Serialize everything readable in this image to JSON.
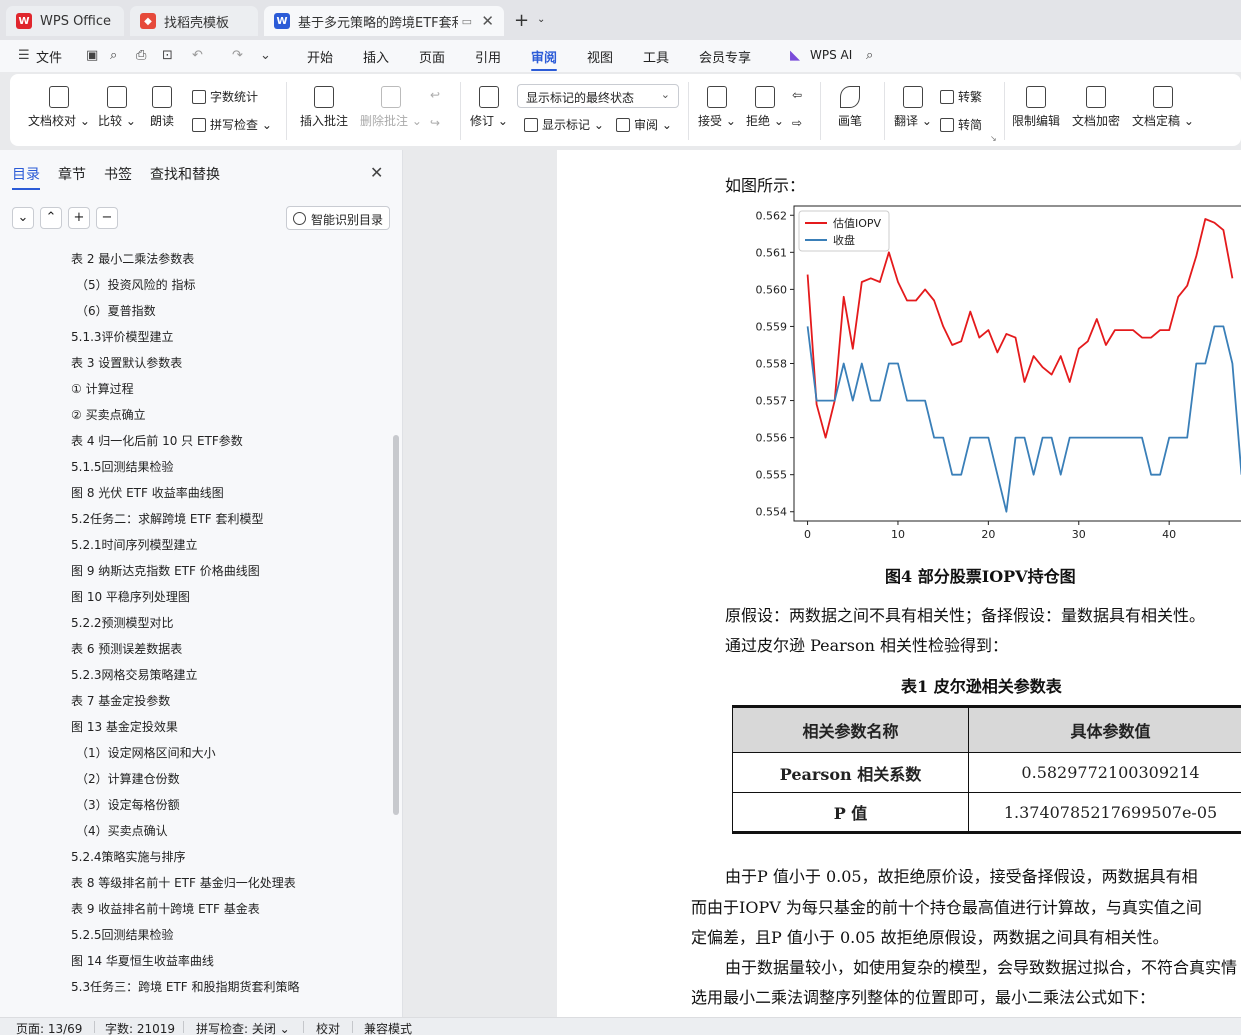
{
  "tabs": [
    {
      "label": "WPS Office"
    },
    {
      "label": "找稻壳模板"
    },
    {
      "label": "基于多元策略的跨境ETF套利策"
    }
  ],
  "menu": {
    "file": "文件",
    "items": [
      "开始",
      "插入",
      "页面",
      "引用",
      "审阅",
      "视图",
      "工具",
      "会员专享"
    ],
    "active": "审阅",
    "ai": "WPS AI"
  },
  "ribbon": {
    "doc_check": "文档校对",
    "compare": "比较",
    "read_aloud": "朗读",
    "word_count": "字数统计",
    "spell_check": "拼写检查",
    "insert_comment": "插入批注",
    "delete_comment": "删除批注",
    "revise": "修订",
    "display_dropdown": "显示标记的最终状态",
    "show_markup": "显示标记",
    "review": "审阅",
    "accept": "接受",
    "reject": "拒绝",
    "pen": "画笔",
    "translate": "翻译",
    "to_traditional": "转繁",
    "to_simplified": "转简",
    "restrict_edit": "限制编辑",
    "encrypt": "文档加密",
    "finalize": "文档定稿"
  },
  "sidebar": {
    "tabs": [
      "目录",
      "章节",
      "书签",
      "查找和替换"
    ],
    "smart_toc": "智能识别目录",
    "toc": [
      {
        "text": "表 2  最小二乘法参数表",
        "indent": 0
      },
      {
        "text": "（5）投资风险的    指标",
        "indent": 1
      },
      {
        "text": "（6）夏普指数",
        "indent": 1
      },
      {
        "text": "5.1.3评价模型建立",
        "indent": 0
      },
      {
        "text": "表 3  设置默认参数表",
        "indent": 0
      },
      {
        "text": "① 计算过程",
        "indent": 0
      },
      {
        "text": "② 买卖点确立",
        "indent": 0
      },
      {
        "text": "表 4  归一化后前 10 只 ETF参数",
        "indent": 0
      },
      {
        "text": "5.1.5回测结果检验",
        "indent": 0
      },
      {
        "text": "图 8  光伏 ETF 收益率曲线图",
        "indent": 0
      },
      {
        "text": "5.2任务二：求解跨境 ETF 套利模型",
        "indent": 0
      },
      {
        "text": "5.2.1时间序列模型建立",
        "indent": 0
      },
      {
        "text": "图 9  纳斯达克指数 ETF 价格曲线图",
        "indent": 0
      },
      {
        "text": "图 10  平稳序列处理图",
        "indent": 0
      },
      {
        "text": "5.2.2预测模型对比",
        "indent": 0
      },
      {
        "text": "表 6  预测误差数据表",
        "indent": 0
      },
      {
        "text": "5.2.3网格交易策略建立",
        "indent": 0
      },
      {
        "text": "表 7  基金定投参数",
        "indent": 0
      },
      {
        "text": "图 13  基金定投效果",
        "indent": 0
      },
      {
        "text": "（1）设定网格区间和大小",
        "indent": 1
      },
      {
        "text": "（2）计算建仓份数",
        "indent": 1
      },
      {
        "text": "（3）设定每格份额",
        "indent": 1
      },
      {
        "text": "（4）买卖点确认",
        "indent": 1
      },
      {
        "text": "5.2.4策略实施与排序",
        "indent": 0
      },
      {
        "text": "表 8  等级排名前十 ETF 基金归一化处理表",
        "indent": 0
      },
      {
        "text": "表 9  收益排名前十跨境 ETF 基金表",
        "indent": 0
      },
      {
        "text": "5.2.5回测结果检验",
        "indent": 0
      },
      {
        "text": "图 14  华夏恒生收益率曲线",
        "indent": 0
      },
      {
        "text": "5.3任务三：跨境 ETF 和股指期货套利策略",
        "indent": 0
      }
    ]
  },
  "document": {
    "intro": "如图所示：",
    "figure_caption": "图4     部分股票IOPV持仓图",
    "para1": "原假设：两数据之间不具有相关性；备择假设：量数据具有相关性。",
    "para2": "通过皮尔逊 Pearson 相关性检验得到：",
    "table_caption": "表1     皮尔逊相关参数表",
    "table": {
      "headers": [
        "相关参数名称",
        "具体参数值"
      ],
      "rows": [
        [
          "Pearson 相关系数",
          "0.5829772100309214"
        ],
        [
          "P 值",
          "1.3740785217699507e-05"
        ]
      ]
    },
    "para3": "由于P 值小于 0.05，故拒绝原价设，接受备择假设，两数据具有相",
    "para4": "而由于IOPV 为每只基金的前十个持仓最高值进行计算故，与真实值之间",
    "para5": "定偏差，且P 值小于 0.05 故拒绝原假设，两数据之间具有相关性。",
    "para6": "由于数据量较小，如使用复杂的模型，会导致数据过拟合，不符合真实情",
    "para7": "选用最小二乘法调整序列整体的位置即可，最小二乘法公式如下："
  },
  "chart_data": {
    "type": "line",
    "xlim": [
      -1.5,
      48.5
    ],
    "ylim": [
      0.55375,
      0.56225
    ],
    "x_ticks": [
      0,
      10,
      20,
      30,
      40
    ],
    "y_ticks": [
      0.554,
      0.555,
      0.556,
      0.557,
      0.558,
      0.559,
      0.56,
      0.561,
      0.562
    ],
    "y_tick_labels": [
      "0.554",
      "0.555",
      "0.556",
      "0.557",
      "0.558",
      "0.559",
      "0.560",
      "0.561",
      "0.562"
    ],
    "legend_position": "top-left",
    "grid": false,
    "series": [
      {
        "name": "估值IOPV",
        "color": "#e41a1c",
        "values": [
          0.5604,
          0.5569,
          0.556,
          0.557,
          0.5598,
          0.5584,
          0.5602,
          0.5603,
          0.5602,
          0.561,
          0.5602,
          0.5597,
          0.5597,
          0.56,
          0.5597,
          0.559,
          0.5585,
          0.5586,
          0.5594,
          0.5587,
          0.5589,
          0.5583,
          0.5588,
          0.5587,
          0.5575,
          0.5582,
          0.5579,
          0.5577,
          0.5582,
          0.5575,
          0.5584,
          0.5586,
          0.5592,
          0.5585,
          0.5589,
          0.5589,
          0.5589,
          0.5587,
          0.5587,
          0.5589,
          0.5589,
          0.5598,
          0.5601,
          0.5609,
          0.5619,
          0.5618,
          0.5616,
          0.5603
        ]
      },
      {
        "name": "收盘",
        "color": "#3a7fb8",
        "values": [
          0.559,
          0.557,
          0.557,
          0.557,
          0.558,
          0.557,
          0.558,
          0.557,
          0.557,
          0.558,
          0.558,
          0.557,
          0.557,
          0.557,
          0.556,
          0.556,
          0.555,
          0.555,
          0.556,
          0.556,
          0.556,
          0.555,
          0.554,
          0.556,
          0.556,
          0.555,
          0.556,
          0.556,
          0.555,
          0.556,
          0.556,
          0.556,
          0.556,
          0.556,
          0.556,
          0.556,
          0.556,
          0.556,
          0.555,
          0.555,
          0.556,
          0.556,
          0.556,
          0.558,
          0.558,
          0.559,
          0.559,
          0.558,
          0.555
        ]
      }
    ]
  },
  "status": {
    "page": "页面: 13/69",
    "words": "字数: 21019",
    "spell": "拼写检查: 关闭",
    "proof": "校对",
    "compat": "兼容模式"
  }
}
